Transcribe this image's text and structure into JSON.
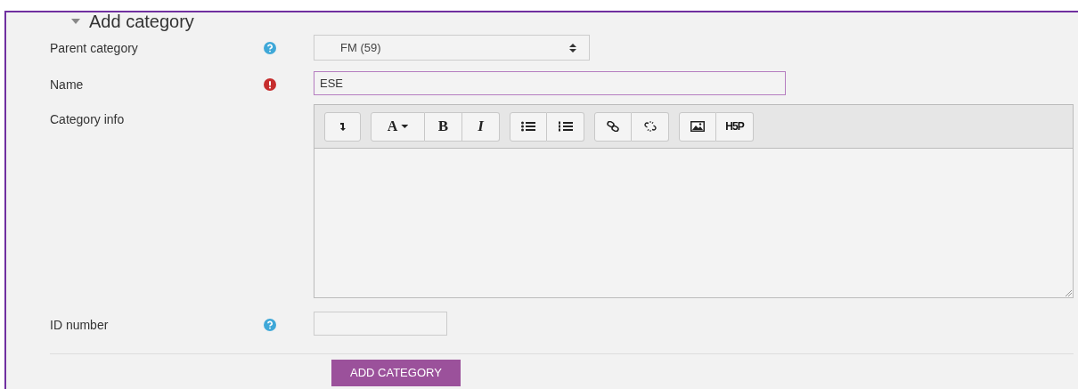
{
  "section": {
    "title": "Add category",
    "expanded": true
  },
  "fields": [
    {
      "kind": "select",
      "label": "Parent category",
      "help": true,
      "value": "FM (59)"
    },
    {
      "kind": "text",
      "label": "Name",
      "required": true,
      "value": "ESE",
      "focused": true
    },
    {
      "kind": "editor",
      "label": "Category info"
    },
    {
      "kind": "short",
      "label": "ID number",
      "help": true
    }
  ],
  "toolbar": [
    [
      {
        "kind": "collapse"
      }
    ],
    [
      {
        "kind": "dropdown",
        "label": "A"
      },
      {
        "kind": "bold",
        "label": "B"
      },
      {
        "kind": "italic",
        "label": "I"
      }
    ],
    [
      {
        "kind": "bullets"
      },
      {
        "kind": "numbers"
      }
    ],
    [
      {
        "kind": "link"
      },
      {
        "kind": "unlink"
      }
    ],
    [
      {
        "kind": "image"
      },
      {
        "kind": "logo",
        "label": "H5P"
      }
    ]
  ],
  "submit": "ADD CATEGORY"
}
